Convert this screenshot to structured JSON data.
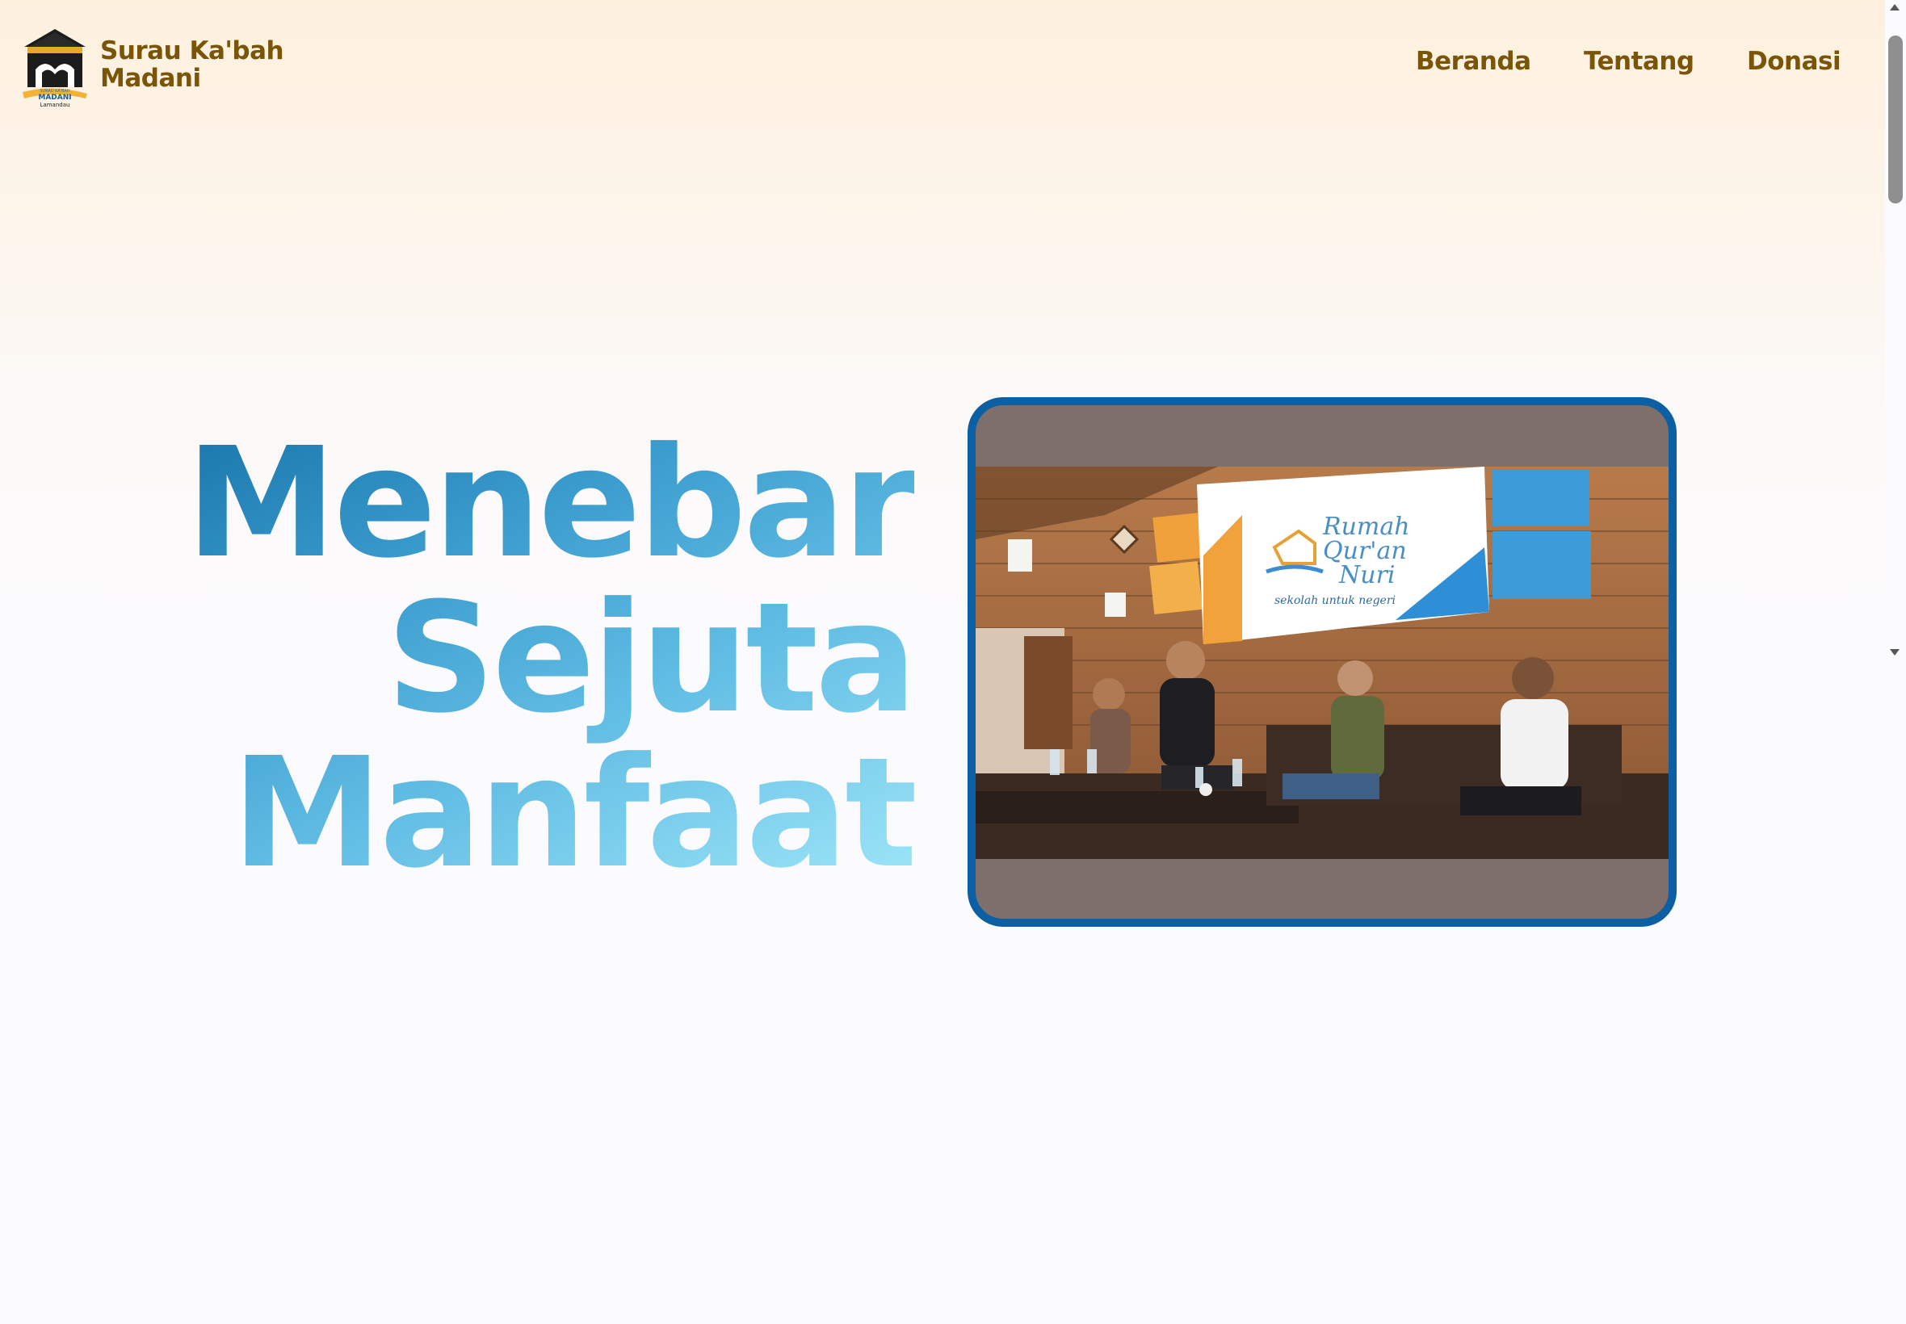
{
  "brand": {
    "line1": "Surau Ka'bah",
    "line2": "Madani",
    "logo_icon": "kaaba-mosque-logo-icon",
    "logo_text_small": "SURAU KA'BAH",
    "logo_text_main": "MADANI",
    "logo_text_sub": "Lamandau"
  },
  "nav": {
    "items": [
      {
        "label": "Beranda"
      },
      {
        "label": "Tentang"
      },
      {
        "label": "Donasi"
      }
    ]
  },
  "hero": {
    "title_lines": [
      "Menebar",
      "Sejuta",
      "Manfaat"
    ],
    "image": {
      "description": "photo of four men seated at a discussion panel in front of a wooden wall",
      "banner_text": [
        "Rumah",
        "Qur'an",
        "Nuri"
      ],
      "banner_tagline": "sekolah untuk negeri"
    }
  },
  "colors": {
    "brand_text": "#7a5407",
    "frame_border": "#0d5fa3",
    "title_gradient_start": "#1a76ac",
    "title_gradient_end": "#9fe6f8"
  }
}
